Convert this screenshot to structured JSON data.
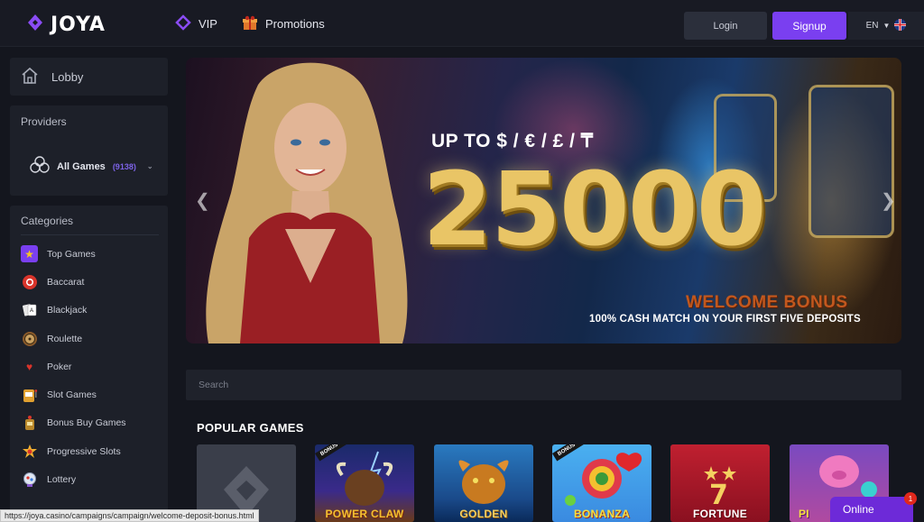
{
  "header": {
    "brand": "JOYA",
    "nav": {
      "vip": "VIP",
      "promotions": "Promotions"
    },
    "login_label": "Login",
    "signup_label": "Signup",
    "lang": "EN"
  },
  "sidebar": {
    "lobby_label": "Lobby",
    "providers_title": "Providers",
    "all_games_label": "All Games",
    "all_games_count": "(9138)",
    "categories_title": "Categories",
    "categories": [
      {
        "label": "Top Games",
        "icon": "star-icon"
      },
      {
        "label": "Baccarat",
        "icon": "chip-icon"
      },
      {
        "label": "Blackjack",
        "icon": "cards-icon"
      },
      {
        "label": "Roulette",
        "icon": "roulette-icon"
      },
      {
        "label": "Poker",
        "icon": "poker-icon"
      },
      {
        "label": "Slot Games",
        "icon": "slot-machine-icon"
      },
      {
        "label": "Bonus Buy Games",
        "icon": "bonus-buy-icon"
      },
      {
        "label": "Progressive Slots",
        "icon": "progressive-icon"
      },
      {
        "label": "Lottery",
        "icon": "lottery-icon"
      }
    ]
  },
  "banner": {
    "up_to": "UP TO $ / € / £ / ₸",
    "amount": "25000",
    "welcome": "WELCOME BONUS",
    "subline": "100% CASH MATCH ON YOUR FIRST FIVE DEPOSITS"
  },
  "search": {
    "placeholder": "Search"
  },
  "popular": {
    "title": "POPULAR GAMES",
    "games": [
      {
        "label": ""
      },
      {
        "label": "POWER CLAW",
        "ribbon": "BONUS BUY"
      },
      {
        "label": "GOLDEN"
      },
      {
        "label": "BONANZA",
        "ribbon": "BONUS BUY"
      },
      {
        "label": "FORTUNE"
      },
      {
        "label": "PI"
      }
    ]
  },
  "statusbar": {
    "url": "https://joya.casino/campaigns/campaign/welcome-deposit-bonus.html"
  },
  "chat": {
    "label": "Online",
    "badge": "1"
  },
  "colors": {
    "accent": "#7a3ff0",
    "background": "#14161e",
    "panel": "#1d2029"
  }
}
